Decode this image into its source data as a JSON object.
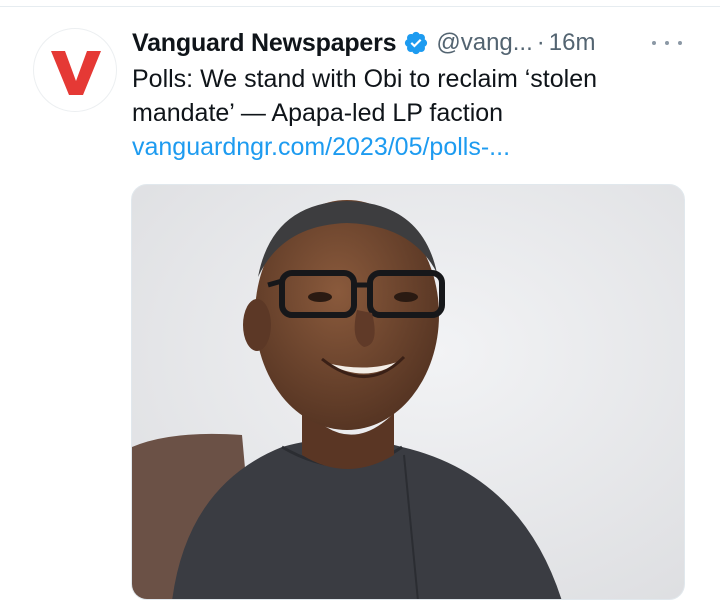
{
  "tweet": {
    "author": {
      "display_name": "Vanguard Newspapers",
      "handle": "@vang...",
      "separator": "·",
      "timestamp": "16m",
      "avatar_letter": "V",
      "avatar_color": "#e53935",
      "verified_icon": "verified-badge-icon"
    },
    "more_icon": "more-horizontal-icon",
    "text_lines": [
      "Polls: We stand with Obi to reclaim ‘stolen",
      "mandate’ — Apapa-led LP faction"
    ],
    "link": "vanguardngr.com/2023/05/polls-...",
    "media": {
      "type": "photo",
      "subject": "portrait-photo"
    }
  },
  "colors": {
    "text_primary": "#0f1419",
    "text_secondary": "#536471",
    "link": "#1d9bf0",
    "verified": "#1d9bf0"
  }
}
